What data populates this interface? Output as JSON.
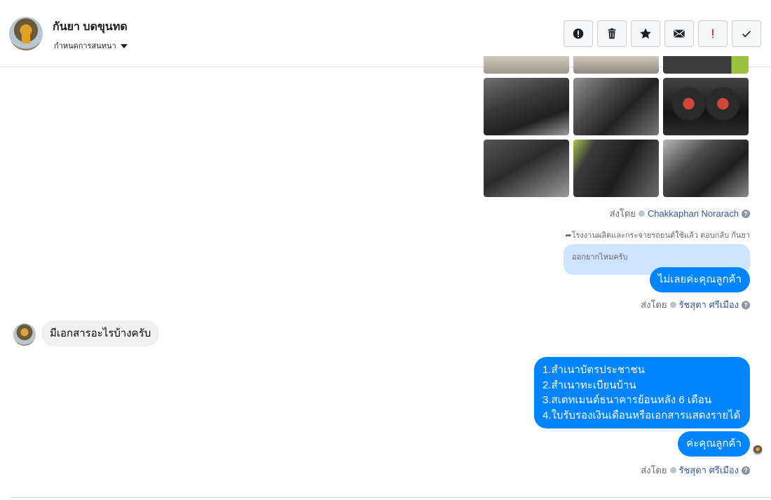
{
  "header": {
    "name": "กันยา บดขุนทด",
    "subtitle": "กำหนดการสนทนา"
  },
  "actions": [
    {
      "name": "spam-button",
      "icon": "alert-circle-icon"
    },
    {
      "name": "delete-button",
      "icon": "trash-icon"
    },
    {
      "name": "star-button",
      "icon": "star-icon"
    },
    {
      "name": "mark-unread-button",
      "icon": "envelope-icon"
    },
    {
      "name": "follow-up-button",
      "icon": "exclamation-icon"
    },
    {
      "name": "done-button",
      "icon": "check-icon"
    }
  ],
  "colors": {
    "accent": "#0084ff",
    "quoted": "#cfe4ff",
    "link": "#385898"
  },
  "messages": {
    "photos_sent_by_prefix": "ส่งโดย",
    "photos_sent_by": "Chakkaphan Norarach",
    "reply_note": "โรงงานผลิตและกระจายรถยนต์ใช้แล้ว ตอบกลับ กันยา",
    "quoted_text": "ออกยากไหมครับ",
    "reply_text": "ไม่เลยค่ะคุณลูกค้า",
    "sent_by_prefix": "ส่งโดย",
    "sent_by_1": "รัชสุดา ศรีเมือง",
    "incoming_text": "มีเอกสารอะไรบ้างครับ",
    "list_items": [
      "1.สำเนาบัตรประชาชน",
      "2.สำเนาทะเบียนบ้าน",
      "3.สเตทเมนต์ธนาคารย้อนหลัง 6 เดือน",
      "4.ใบรับรองเงินเดือนหรือเอกสารแสดงรายได้"
    ],
    "closing_text": "ค่ะคุณลูกค้า",
    "sent_by_2": "รัชสุดา ศรีเมือง"
  }
}
